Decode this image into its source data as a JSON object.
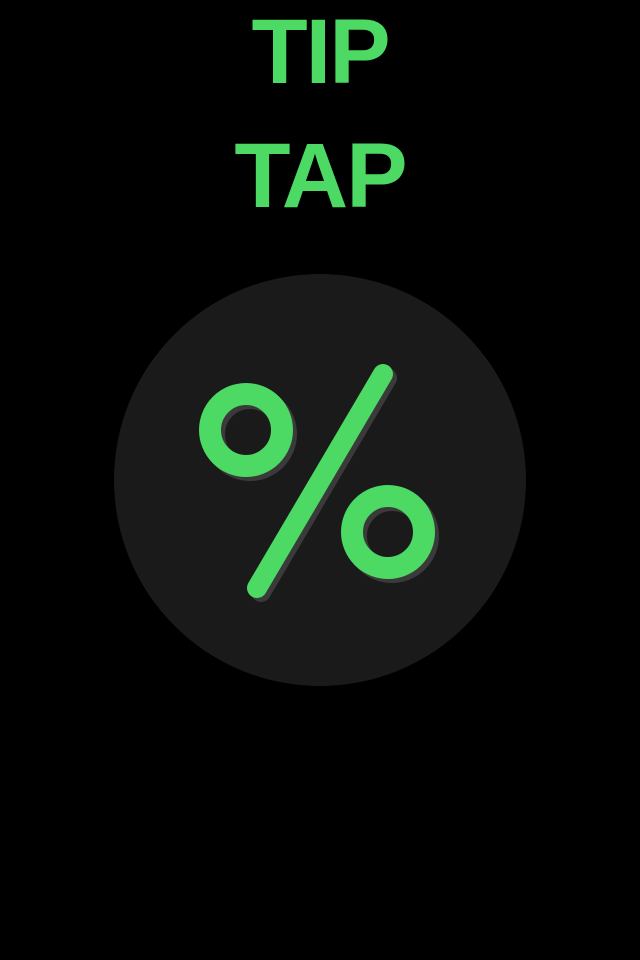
{
  "title": {
    "line1": "TIP",
    "line2": "TAP"
  },
  "main_button": {
    "icon": "percent-icon"
  },
  "colors": {
    "accent": "#4cd964",
    "background": "#000000",
    "button": "#1a1a1a"
  }
}
